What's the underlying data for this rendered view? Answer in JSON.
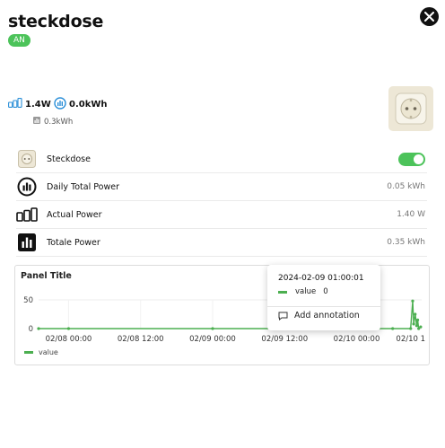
{
  "header": {
    "title": "steckdose",
    "status_badge": "AN"
  },
  "metrics": {
    "power": "1.4W",
    "energy": "0.0kWh",
    "sub_energy": "0.3kWh"
  },
  "rows": [
    {
      "label": "Steckdose",
      "value": "",
      "icon": "socket-icon",
      "toggle_on": true
    },
    {
      "label": "Daily Total Power",
      "value": "0.05 kWh",
      "icon": "daily-total-icon"
    },
    {
      "label": "Actual Power",
      "value": "1.40 W",
      "icon": "power-bars-icon"
    },
    {
      "label": "Totale Power",
      "value": "0.35 kWh",
      "icon": "total-power-icon"
    }
  ],
  "panel": {
    "title": "Panel Title"
  },
  "chart_data": {
    "type": "line",
    "title": "Panel Title",
    "yticks": [
      "50",
      "0"
    ],
    "ylim": [
      0,
      50
    ],
    "xticks": [
      "02/08 00:00",
      "02/08 12:00",
      "02/09 00:00",
      "02/09 12:00",
      "02/10 00:00",
      "02/10 1"
    ],
    "series": [
      {
        "name": "value",
        "color": "#4caf50",
        "points": [
          {
            "x": "2024-02-07 19:00",
            "y": 0
          },
          {
            "x": "2024-02-08 00:00",
            "y": 0
          },
          {
            "x": "2024-02-09 00:00",
            "y": 0
          },
          {
            "x": "2024-02-09 12:00",
            "y": 0
          },
          {
            "x": "2024-02-10 06:00",
            "y": 0
          },
          {
            "x": "2024-02-10 09:00",
            "y": 0
          },
          {
            "x": "2024-02-10 09:20",
            "y": 48
          },
          {
            "x": "2024-02-10 09:30",
            "y": 8
          },
          {
            "x": "2024-02-10 09:45",
            "y": 25
          },
          {
            "x": "2024-02-10 10:00",
            "y": 5
          },
          {
            "x": "2024-02-10 10:10",
            "y": 15
          },
          {
            "x": "2024-02-10 10:20",
            "y": 0
          },
          {
            "x": "2024-02-10 10:40",
            "y": 3
          }
        ]
      }
    ],
    "legend": [
      "value"
    ],
    "grid": true
  },
  "tooltip": {
    "date": "2024-02-09 01:00:01",
    "series_label": "value",
    "series_value": "0",
    "annotation_label": "Add annotation"
  },
  "colors": {
    "accent_green": "#4cc35a",
    "series_green": "#4caf50",
    "metric_blue": "#2b8fd8"
  }
}
